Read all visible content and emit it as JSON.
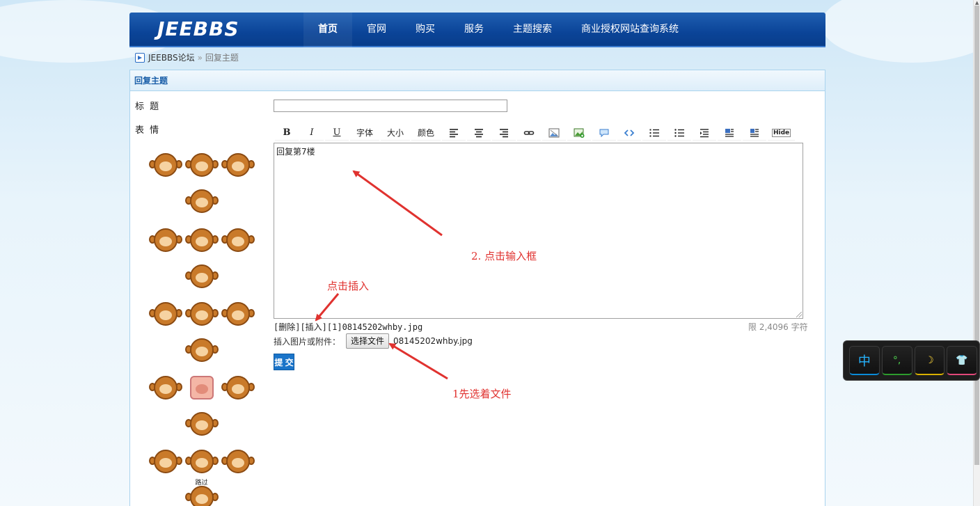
{
  "header": {
    "logo": "JEEBBS",
    "nav": [
      "首页",
      "官网",
      "购买",
      "服务",
      "主题搜索",
      "商业授权网站查询系统"
    ]
  },
  "breadcrumb": {
    "home": "JEEBBS论坛",
    "sep": "»",
    "current": "回复主题"
  },
  "panel": {
    "title": "回复主题"
  },
  "form": {
    "title_label": "标 题",
    "emoji_label": "表 情",
    "title_value": "",
    "toolbar": {
      "bold": "B",
      "italic": "I",
      "underline": "U",
      "font": "字体",
      "size": "大小",
      "color": "颜色",
      "hide": "Hide"
    },
    "editor_text": "回复第7楼",
    "attachment_line": "[删除][插入][1]08145202whby.jpg",
    "limit_text": "限 2,4096 字符",
    "file_label": "插入图片或附件：",
    "file_button": "选择文件",
    "file_name": "08145202whby.jpg",
    "submit": "提 交"
  },
  "emoji_caption": "路过",
  "annotations": {
    "click_input": "2. 点击输入框",
    "click_insert": "点击插入",
    "select_file": "1先选着文件"
  },
  "ime": {
    "zh": "中",
    "punc": "°,",
    "moon": "☽",
    "skin": "👕"
  },
  "colors": {
    "nav_bg": "#0b4498",
    "annotation": "#e0322f",
    "submit_bg": "#1a74c9",
    "panel_border": "#a9d3ee"
  }
}
